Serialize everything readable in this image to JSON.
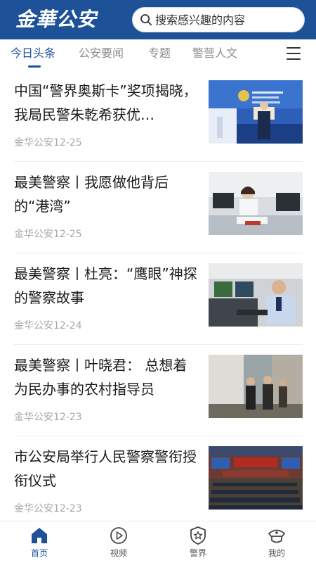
{
  "header": {
    "logo_text": "金華公安",
    "search_placeholder": "搜索感兴趣的内容",
    "search_icon": "search-icon"
  },
  "tabs": [
    {
      "label": "今日头条",
      "active": true
    },
    {
      "label": "公安要闻",
      "active": false
    },
    {
      "label": "专题",
      "active": false
    },
    {
      "label": "警营人文",
      "active": false
    }
  ],
  "menu_icon": "hamburger-menu-icon",
  "news": [
    {
      "title": "中国“警界奥斯卡”奖项揭晓，我局民警朱乾希获优…",
      "source": "金华公安",
      "date": "12-25",
      "meta": "金华公安12-25",
      "thumb": "award-ceremony-photo"
    },
    {
      "title": "最美警察丨我愿做他背后的“港湾”",
      "source": "金华公安",
      "date": "12-25",
      "meta": "金华公安12-25",
      "thumb": "police-officer-at-desk-photo"
    },
    {
      "title": "最美警察丨杜亮：“鹰眼”神探的警察故事",
      "source": "金华公安",
      "date": "12-24",
      "meta": "金华公安12-24",
      "thumb": "officer-at-monitors-photo"
    },
    {
      "title": "最美警察丨叶晓君： 总想着为民办事的农村指导员",
      "source": "金华公安",
      "date": "12-23",
      "meta": "金华公安12-23",
      "thumb": "village-visit-photo"
    },
    {
      "title": "市公安局举行人民警察警衔授衔仪式",
      "source": "金华公安",
      "date": "12-23",
      "meta": "金华公安12-23",
      "thumb": "auditorium-ceremony-photo"
    }
  ],
  "bottom_nav": [
    {
      "label": "首页",
      "icon": "home-icon",
      "active": true
    },
    {
      "label": "视频",
      "icon": "play-icon",
      "active": false
    },
    {
      "label": "警界",
      "icon": "police-badge-icon",
      "active": false
    },
    {
      "label": "我的",
      "icon": "police-cap-icon",
      "active": false
    }
  ],
  "colors": {
    "brand_blue": "#1d5299",
    "meta_gray": "#a8a8a8",
    "inactive_tab": "#8d8d8d"
  }
}
